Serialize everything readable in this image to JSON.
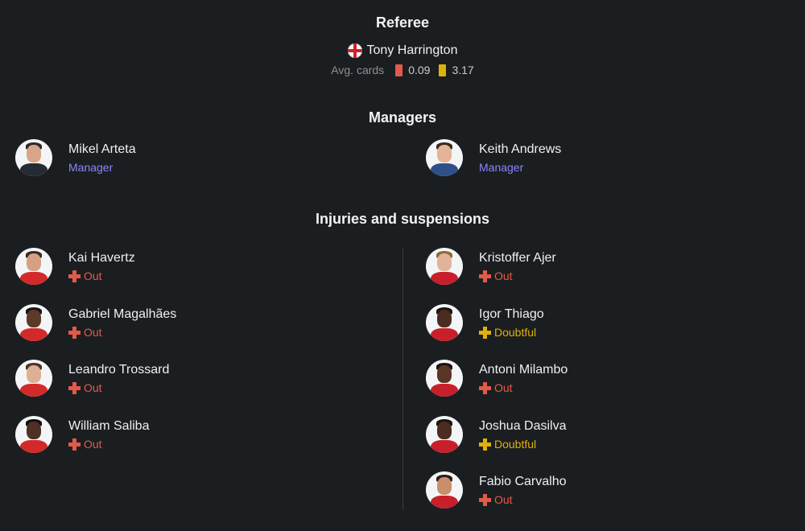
{
  "referee": {
    "title": "Referee",
    "name": "Tony Harrington",
    "country_flag_icon": "england-flag-icon",
    "avg_cards_label": "Avg. cards",
    "red_avg": "0.09",
    "yellow_avg": "3.17",
    "colors": {
      "red_card": "#e25a49",
      "yellow_card": "#e0b10a"
    }
  },
  "managers": {
    "title": "Managers",
    "home": {
      "name": "Mikel Arteta",
      "role": "Manager"
    },
    "away": {
      "name": "Keith Andrews",
      "role": "Manager"
    }
  },
  "injuries": {
    "title": "Injuries and suspensions",
    "status_colors": {
      "Out": "#e25a49",
      "Doubtful": "#e0b10a"
    },
    "home": [
      {
        "name": "Kai Havertz",
        "status": "Out"
      },
      {
        "name": "Gabriel Magalhães",
        "status": "Out"
      },
      {
        "name": "Leandro Trossard",
        "status": "Out"
      },
      {
        "name": "William Saliba",
        "status": "Out"
      }
    ],
    "away": [
      {
        "name": "Kristoffer Ajer",
        "status": "Out"
      },
      {
        "name": "Igor Thiago",
        "status": "Doubtful"
      },
      {
        "name": "Antoni Milambo",
        "status": "Out"
      },
      {
        "name": "Joshua Dasilva",
        "status": "Doubtful"
      },
      {
        "name": "Fabio Carvalho",
        "status": "Out"
      }
    ]
  },
  "colors": {
    "manager_role": "#8a84ff",
    "background": "#1b1e20"
  }
}
